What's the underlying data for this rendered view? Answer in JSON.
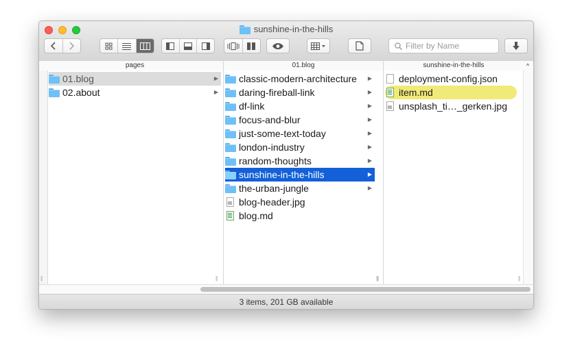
{
  "window": {
    "title": "sunshine-in-the-hills",
    "status": "3 items, 201 GB available"
  },
  "toolbar": {
    "back_icon": "chevron-left",
    "forward_icon": "chevron-right",
    "view_icons": [
      "icon-view",
      "list-view",
      "column-view"
    ],
    "pane_icons": [
      "sidebar-left",
      "preview-bottom",
      "sidebar-right"
    ],
    "gallery_icons": [
      "coverflow",
      "split-view"
    ],
    "quicklook_icon": "eye",
    "arrange_icon": "grid-arrange",
    "share_icon": "document",
    "search_placeholder": "Filter by Name",
    "download_icon": "down-arrow"
  },
  "columns": [
    {
      "header": "pages",
      "items": [
        {
          "label": "01.blog",
          "type": "folder",
          "selected": "gray"
        },
        {
          "label": "02.about",
          "type": "folder"
        }
      ]
    },
    {
      "header": "01.blog",
      "items": [
        {
          "label": "classic-modern-architecture",
          "type": "folder"
        },
        {
          "label": "daring-fireball-link",
          "type": "folder"
        },
        {
          "label": "df-link",
          "type": "folder"
        },
        {
          "label": "focus-and-blur",
          "type": "folder"
        },
        {
          "label": "just-some-text-today",
          "type": "folder"
        },
        {
          "label": "london-industry",
          "type": "folder"
        },
        {
          "label": "random-thoughts",
          "type": "folder"
        },
        {
          "label": "sunshine-in-the-hills",
          "type": "folder",
          "selected": "blue"
        },
        {
          "label": "the-urban-jungle",
          "type": "folder"
        },
        {
          "label": "blog-header.jpg",
          "type": "image"
        },
        {
          "label": "blog.md",
          "type": "markdown"
        }
      ]
    },
    {
      "header": "sunshine-in-the-hills",
      "items": [
        {
          "label": "deployment-config.json",
          "type": "document"
        },
        {
          "label": "item.md",
          "type": "markdown",
          "highlight": "yellow"
        },
        {
          "label": "unsplash_ti…_gerken.jpg",
          "type": "image"
        }
      ]
    }
  ],
  "colors": {
    "selection_blue": "#1360d9",
    "highlight_yellow": "#f1ea78",
    "folder_blue": "#6fc0f6"
  }
}
